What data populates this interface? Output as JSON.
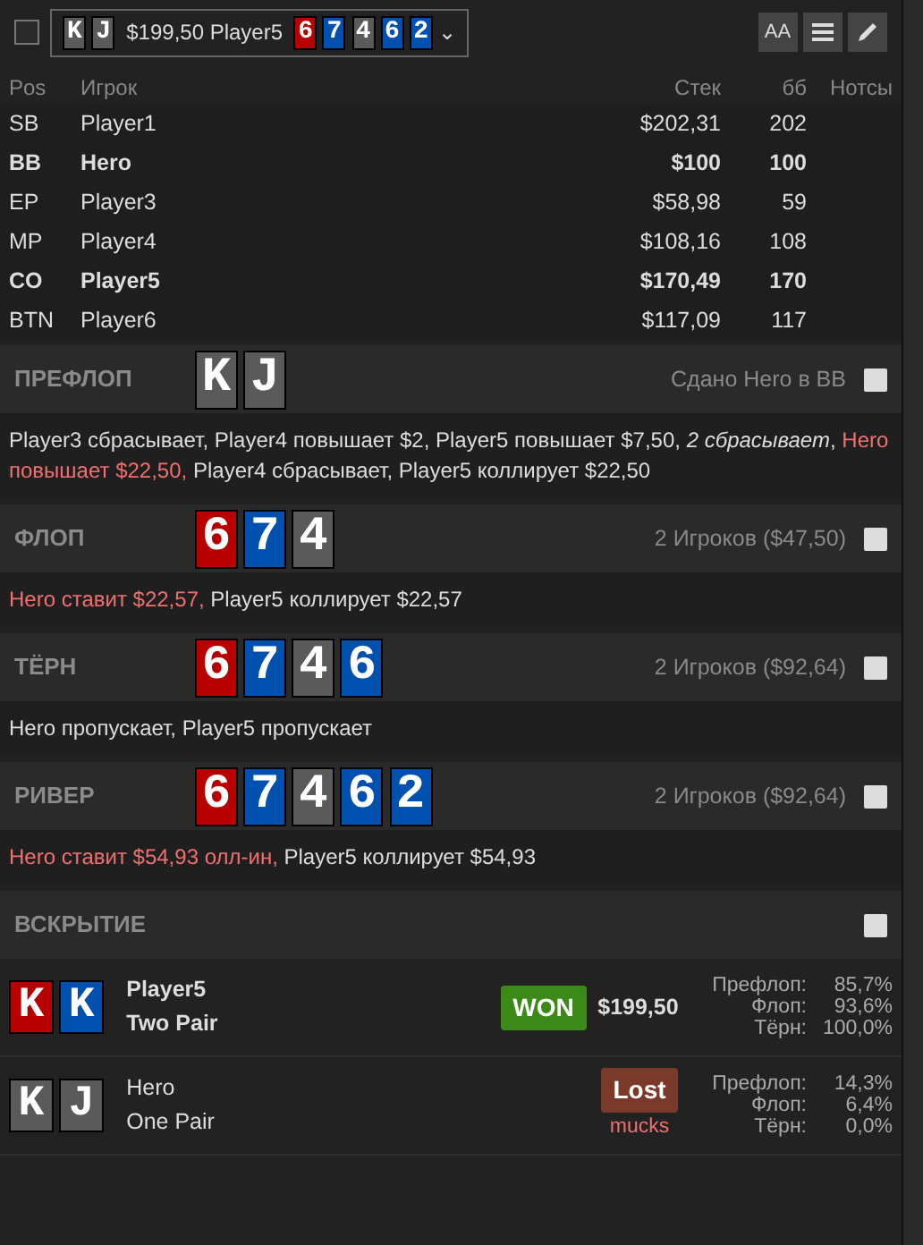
{
  "topbar": {
    "checked": false,
    "hand_cards": [
      {
        "rank": "K",
        "color": "#5a5a5a"
      },
      {
        "rank": "J",
        "color": "#5a5a5a"
      }
    ],
    "summary": "$199,50 Player5",
    "board_cards": [
      {
        "rank": "6",
        "color": "#b80000"
      },
      {
        "rank": "7",
        "color": "#0050b0"
      },
      {
        "rank": "4",
        "color": "#5a5a5a"
      },
      {
        "rank": "6",
        "color": "#0050b0"
      },
      {
        "rank": "2",
        "color": "#0050b0"
      }
    ],
    "caret": "⌄",
    "tools": [
      {
        "kind": "font",
        "label": "AA"
      },
      {
        "kind": "list"
      },
      {
        "kind": "edit"
      }
    ]
  },
  "players": {
    "columns": [
      "Pos",
      "Игрок",
      "Стек",
      "бб",
      "Нотсы"
    ],
    "rows": [
      {
        "pos": "SB",
        "name": "Player1",
        "stack": "$202,31",
        "bb": "202",
        "bold": false
      },
      {
        "pos": "BB",
        "name": "Hero",
        "stack": "$100",
        "bb": "100",
        "bold": true
      },
      {
        "pos": "EP",
        "name": "Player3",
        "stack": "$58,98",
        "bb": "59",
        "bold": false
      },
      {
        "pos": "MP",
        "name": "Player4",
        "stack": "$108,16",
        "bb": "108",
        "bold": false
      },
      {
        "pos": "CO",
        "name": "Player5",
        "stack": "$170,49",
        "bb": "170",
        "bold": true
      },
      {
        "pos": "BTN",
        "name": "Player6",
        "stack": "$117,09",
        "bb": "117",
        "bold": false
      }
    ]
  },
  "streets": [
    {
      "title": "ПРЕФЛОП",
      "cards": [
        {
          "rank": "K",
          "color": "#5a5a5a"
        },
        {
          "rank": "J",
          "color": "#5a5a5a"
        }
      ],
      "info": "Сдано Hero в BB",
      "note_checked": false,
      "actions": [
        {
          "text": "Player3 сбрасывает, Player4 повышает $2, Player5 повышает $7,50, *2 сбрасывает*,",
          "hero": false
        },
        {
          "text": "Hero повышает $22,50,",
          "hero": true
        },
        {
          "text": "Player4 сбрасывает, Player5 коллирует $22,50",
          "hero": false
        }
      ]
    },
    {
      "title": "ФЛОП",
      "cards": [
        {
          "rank": "6",
          "color": "#b80000"
        },
        {
          "rank": "7",
          "color": "#0050b0"
        },
        {
          "rank": "4",
          "color": "#5a5a5a"
        }
      ],
      "info": "2 Игроков ($47,50)",
      "note_checked": false,
      "actions": [
        {
          "text": "Hero ставит $22,57,",
          "hero": true
        },
        {
          "text": "Player5 коллирует $22,57",
          "hero": false
        }
      ]
    },
    {
      "title": "ТЁРН",
      "cards": [
        {
          "rank": "6",
          "color": "#b80000"
        },
        {
          "rank": "7",
          "color": "#0050b0"
        },
        {
          "rank": "4",
          "color": "#5a5a5a"
        },
        {
          "rank": "6",
          "color": "#0050b0"
        }
      ],
      "info": "2 Игроков ($92,64)",
      "note_checked": false,
      "actions": [
        {
          "text": "Hero пропускает, Player5 пропускает",
          "hero": false
        }
      ]
    },
    {
      "title": "РИВЕР",
      "cards": [
        {
          "rank": "6",
          "color": "#b80000"
        },
        {
          "rank": "7",
          "color": "#0050b0"
        },
        {
          "rank": "4",
          "color": "#5a5a5a"
        },
        {
          "rank": "6",
          "color": "#0050b0"
        },
        {
          "rank": "2",
          "color": "#0050b0"
        }
      ],
      "info": "2 Игроков ($92,64)",
      "note_checked": false,
      "actions": [
        {
          "text": "Hero ставит $54,93 олл-ин,",
          "hero": true
        },
        {
          "text": "Player5 коллирует $54,93",
          "hero": false
        }
      ]
    }
  ],
  "showdown": {
    "title": "ВСКРЫТИЕ",
    "note_checked": false,
    "players": [
      {
        "cards": [
          {
            "rank": "K",
            "color": "#b80000"
          },
          {
            "rank": "K",
            "color": "#0050b0"
          }
        ],
        "name": "Player5",
        "hand": "Two Pair",
        "bold": true,
        "result": "WON",
        "kind": "won",
        "amount": "$199,50",
        "equity": [
          {
            "label": "Префлоп:",
            "value": "85,7%"
          },
          {
            "label": "Флоп:",
            "value": "93,6%"
          },
          {
            "label": "Тёрн:",
            "value": "100,0%"
          }
        ]
      },
      {
        "cards": [
          {
            "rank": "K",
            "color": "#5a5a5a"
          },
          {
            "rank": "J",
            "color": "#5a5a5a"
          }
        ],
        "name": "Hero",
        "hand": "One Pair",
        "bold": false,
        "result": "Lost",
        "kind": "lost",
        "sub": "mucks",
        "equity": [
          {
            "label": "Префлоп:",
            "value": "14,3%"
          },
          {
            "label": "Флоп:",
            "value": "6,4%"
          },
          {
            "label": "Тёрн:",
            "value": "0,0%"
          }
        ]
      }
    ]
  }
}
